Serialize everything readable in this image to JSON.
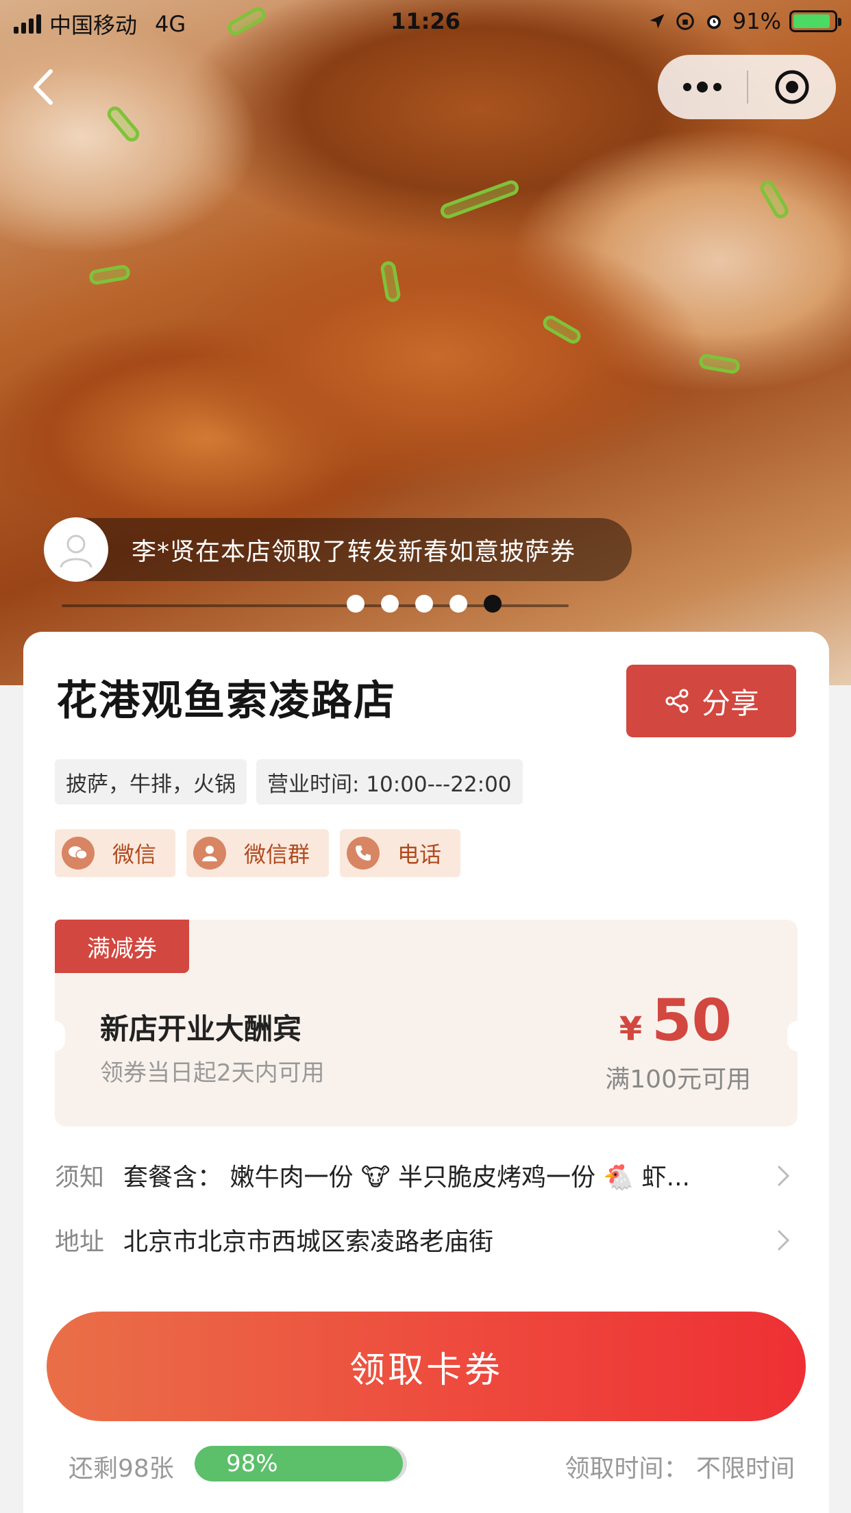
{
  "status_bar": {
    "carrier": "中国移动",
    "network": "4G",
    "time": "11:26",
    "battery": "91%",
    "battery_level": 0.91
  },
  "hero": {
    "ticker_text": "李*贤在本店领取了转发新春如意披萨券",
    "dots_count": 5,
    "active_dot": 5
  },
  "shop": {
    "name": "花港观鱼索凌路店",
    "share_label": "分享",
    "tags": [
      "披萨，牛排，火锅",
      "营业时间: 10:00---22:00"
    ],
    "contacts": [
      {
        "label": "微信",
        "icon": "wechat-icon"
      },
      {
        "label": "微信群",
        "icon": "wechat-group-icon"
      },
      {
        "label": "电话",
        "icon": "phone-icon"
      }
    ]
  },
  "coupon": {
    "type": "满减券",
    "title": "新店开业大酬宾",
    "validity": "领券当日起2天内可用",
    "currency": "¥",
    "amount": "50",
    "condition": "满100元可用"
  },
  "info": {
    "notice_label": "须知",
    "notice_value": "套餐含：  嫩牛肉一份 🐮  半只脆皮烤鸡一份 🐔  虾...",
    "address_label": "地址",
    "address_value": "北京市北京市西城区索凌路老庙街"
  },
  "claim_button": "领取卡券",
  "footer": {
    "remaining": "还剩98张",
    "progress_label": "98%",
    "progress_value": 0.98,
    "claim_time": "领取时间：  不限时间"
  },
  "colors": {
    "accent_red": "#d2473f",
    "progress_green": "#5cbf6a"
  }
}
